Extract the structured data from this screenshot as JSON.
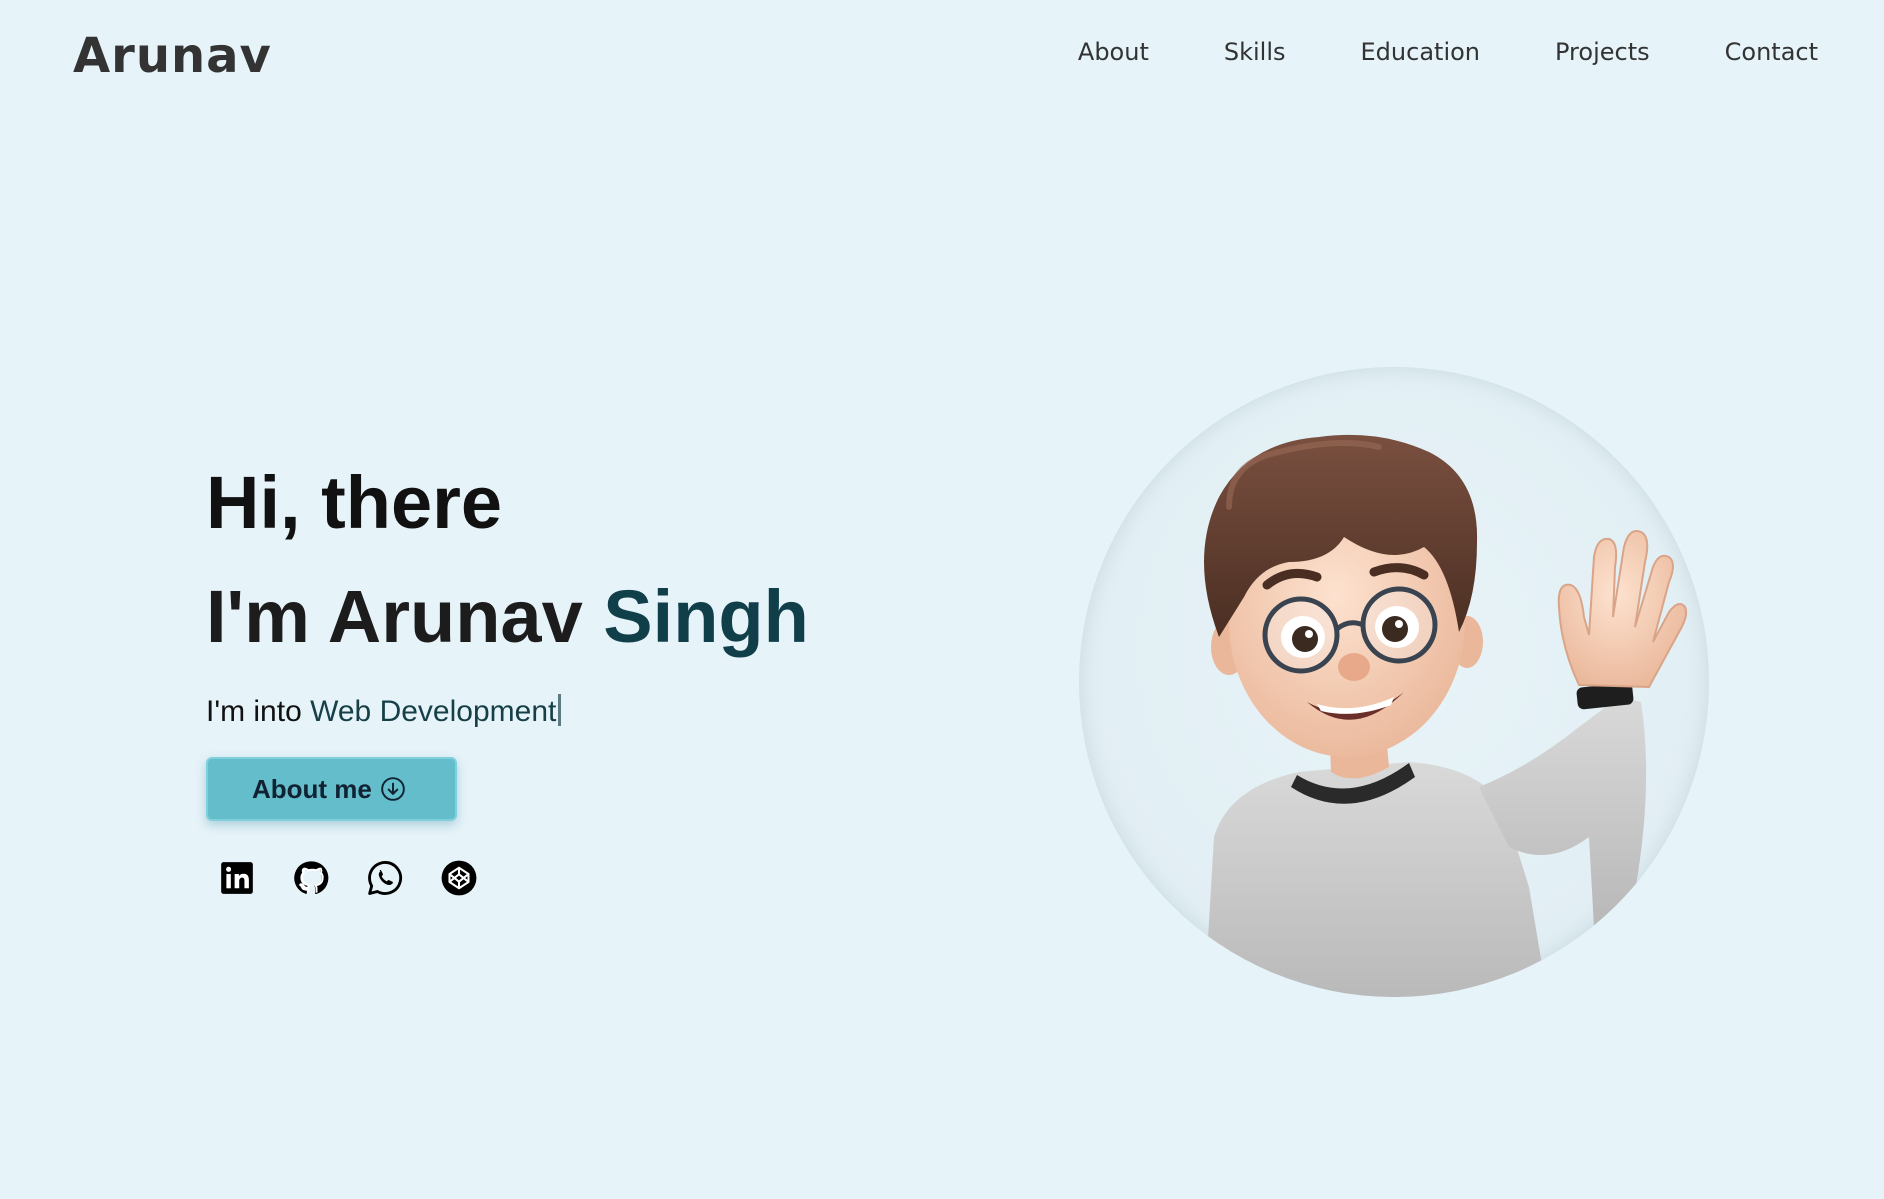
{
  "header": {
    "brand": "Arunav",
    "nav": [
      "About",
      "Skills",
      "Education",
      "Projects",
      "Contact"
    ]
  },
  "hero": {
    "greeting": "Hi, there",
    "name_prefix": "I'm Arunav ",
    "name_accent": "Singh",
    "into_prefix": "I'm into ",
    "into_accent": "Web Development",
    "button_label": "About me",
    "socials": [
      "linkedin-icon",
      "github-icon",
      "whatsapp-icon",
      "codepen-icon"
    ]
  },
  "colors": {
    "background": "#e6f3f9",
    "accent": "#103f4a",
    "button": "#63bdca"
  }
}
